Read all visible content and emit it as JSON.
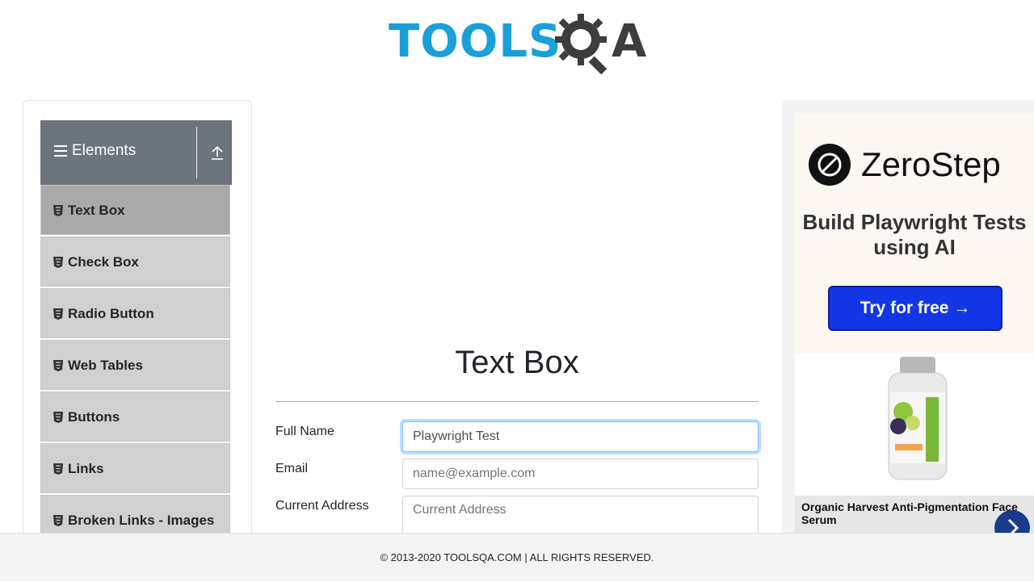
{
  "header": {
    "logo_left": "TOOLS",
    "logo_right": "A",
    "logo_alt": "TOOLSQA"
  },
  "sidebar": {
    "group_title": "Elements",
    "items": [
      {
        "label": "Text Box",
        "active": true
      },
      {
        "label": "Check Box"
      },
      {
        "label": "Radio Button"
      },
      {
        "label": "Web Tables"
      },
      {
        "label": "Buttons"
      },
      {
        "label": "Links"
      },
      {
        "label": "Broken Links - Images"
      }
    ]
  },
  "main": {
    "title": "Text Box",
    "fields": {
      "full_name": {
        "label": "Full Name",
        "value": "Playwright Test"
      },
      "email": {
        "label": "Email",
        "placeholder": "name@example.com"
      },
      "current_address": {
        "label": "Current Address",
        "placeholder": "Current Address"
      }
    }
  },
  "ad": {
    "brand": "ZeroStep",
    "headline": "Build Playwright Tests using AI",
    "cta": "Try for free →",
    "product_caption": "Organic Harvest Anti-Pigmentation Face Serum"
  },
  "footer": {
    "text": "© 2013-2020 TOOLSQA.COM | ALL RIGHTS RESERVED."
  },
  "colors": {
    "logo_blue": "#1a9fd8",
    "logo_dark": "#3d3d3d",
    "group_header_bg": "#6c757d",
    "cta_blue": "#1236e6"
  }
}
